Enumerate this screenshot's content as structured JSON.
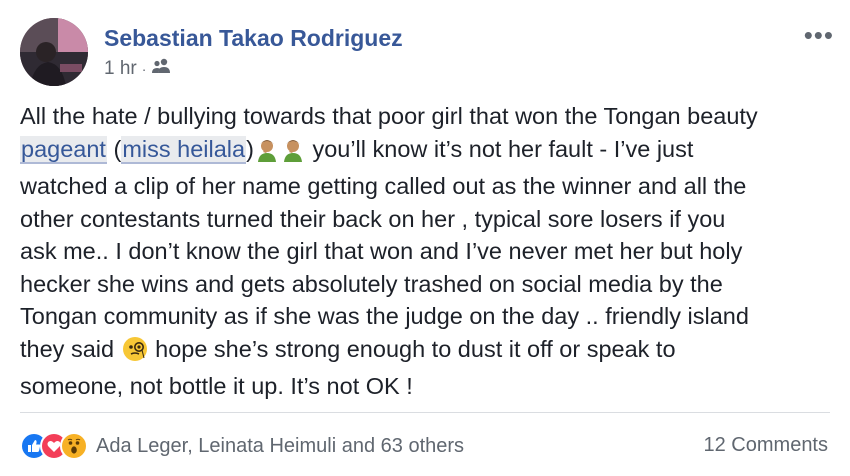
{
  "post": {
    "author": "Sebastian Takao Rodriguez",
    "time": "1 hr",
    "audience_icon": "friends-icon",
    "more_icon": "more-options-icon",
    "text": {
      "line1": "All the hate / bullying towards that poor girl that won the Tongan beauty",
      "tag_pageant": "pageant",
      "paren_open": " (",
      "tag_name": "miss heilala",
      "paren_close": ")",
      "line2_rest": " you’ll know it’s not her fault - I’ve just",
      "line3": "watched a clip of her name getting called out as the winner and all the",
      "line4": "other contestants turned their back on her , typical sore losers if you",
      "line5": "ask me.. I don’t know the girl that won and I’ve never met her but holy",
      "line6": "hecker she wins and gets absolutely trashed on social media by the",
      "line7": "Tongan community as if she was the judge on the day .. friendly island",
      "line8_start": "they said",
      "line8_rest": " hope she’s strong enough to dust it off or speak to",
      "line9": "someone, not bottle it up. It’s not OK !"
    },
    "emojis": [
      "facepalm-man-emoji",
      "facepalm-man-emoji",
      "monocle-face-emoji"
    ]
  },
  "footer": {
    "reactions": [
      "like-reaction-icon",
      "love-reaction-icon",
      "wow-reaction-icon"
    ],
    "reaction_text": "Ada Leger, Leinata Heimuli and 63 others",
    "comments": "12 Comments"
  },
  "colors": {
    "author": "#385898",
    "meta": "#616770",
    "tag_bg": "#e9ebee",
    "like": "#1877f2",
    "love": "#f33e58",
    "wow": "#f7b125"
  }
}
